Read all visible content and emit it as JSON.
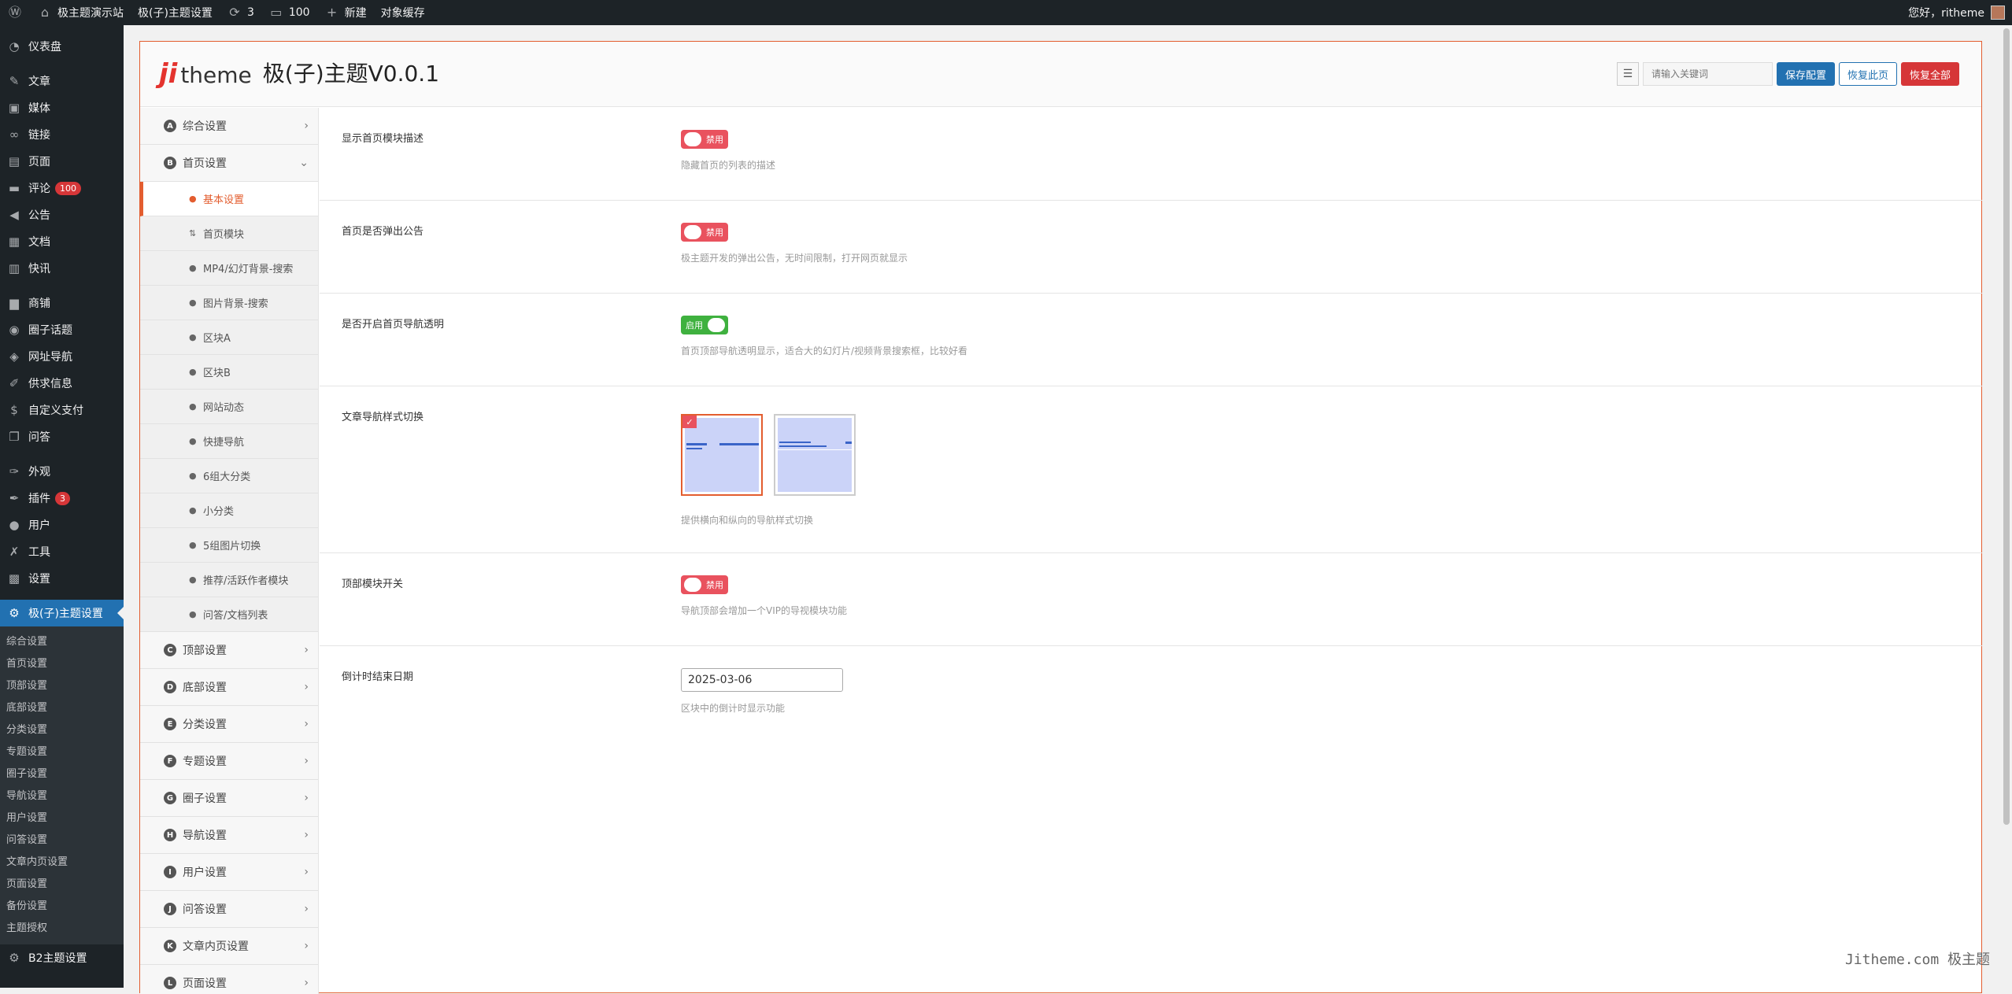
{
  "adminbar": {
    "site_name": "极主题演示站",
    "theme_settings": "极(子)主题设置",
    "updates_count": "3",
    "comments_count": "100",
    "new_label": "新建",
    "cache_label": "对象缓存",
    "greeting": "您好，ritheme"
  },
  "sidebar": {
    "items": [
      {
        "label": "仪表盘",
        "icon": "dashboard-icon"
      },
      {
        "label": "文章",
        "icon": "pin-icon"
      },
      {
        "label": "媒体",
        "icon": "media-icon"
      },
      {
        "label": "链接",
        "icon": "link-icon"
      },
      {
        "label": "页面",
        "icon": "page-icon"
      },
      {
        "label": "评论",
        "icon": "comment-icon",
        "badge": "100"
      },
      {
        "label": "公告",
        "icon": "megaphone-icon"
      },
      {
        "label": "文档",
        "icon": "doc-icon"
      },
      {
        "label": "快讯",
        "icon": "flash-icon"
      },
      {
        "label": "商铺",
        "icon": "shop-icon"
      },
      {
        "label": "圈子话题",
        "icon": "circle-icon"
      },
      {
        "label": "网址导航",
        "icon": "nav-icon"
      },
      {
        "label": "供求信息",
        "icon": "supply-icon"
      },
      {
        "label": "自定义支付",
        "icon": "dollar-icon"
      },
      {
        "label": "问答",
        "icon": "qa-icon"
      },
      {
        "label": "外观",
        "icon": "brush-icon"
      },
      {
        "label": "插件",
        "icon": "plugin-icon",
        "badge": "3"
      },
      {
        "label": "用户",
        "icon": "user-icon"
      },
      {
        "label": "工具",
        "icon": "wrench-icon"
      },
      {
        "label": "设置",
        "icon": "settings-icon"
      }
    ],
    "current": {
      "label": "极(子)主题设置",
      "icon": "gear-icon"
    },
    "submenu": [
      "综合设置",
      "首页设置",
      "顶部设置",
      "底部设置",
      "分类设置",
      "专题设置",
      "圈子设置",
      "导航设置",
      "用户设置",
      "问答设置",
      "文章内页设置",
      "页面设置",
      "备份设置",
      "主题授权"
    ],
    "bottom": {
      "label": "B2主题设置",
      "icon": "gear-icon"
    }
  },
  "header": {
    "logo_ji": "ji",
    "logo_theme": "theme",
    "version_title": "极(子)主题V0.0.1",
    "search_placeholder": "请输入关键词",
    "save_label": "保存配置",
    "reset_page_label": "恢复此页",
    "reset_all_label": "恢复全部"
  },
  "optnav": {
    "top_items": [
      {
        "letter": "A",
        "label": "综合设置",
        "chev": "›"
      },
      {
        "letter": "B",
        "label": "首页设置",
        "chev": "⌄"
      }
    ],
    "subitems": [
      "基本设置",
      "首页模块",
      "MP4/幻灯背景-搜索",
      "图片背景-搜索",
      "区块A",
      "区块B",
      "网站动态",
      "快捷导航",
      "6组大分类",
      "小分类",
      "5组图片切换",
      "推荐/活跃作者模块",
      "问答/文档列表"
    ],
    "active_sub": 0,
    "bottom_items": [
      {
        "letter": "C",
        "label": "顶部设置"
      },
      {
        "letter": "D",
        "label": "底部设置"
      },
      {
        "letter": "E",
        "label": "分类设置"
      },
      {
        "letter": "F",
        "label": "专题设置"
      },
      {
        "letter": "G",
        "label": "圈子设置"
      },
      {
        "letter": "H",
        "label": "导航设置"
      },
      {
        "letter": "I",
        "label": "用户设置"
      },
      {
        "letter": "J",
        "label": "问答设置"
      },
      {
        "letter": "K",
        "label": "文章内页设置"
      },
      {
        "letter": "L",
        "label": "页面设置"
      }
    ]
  },
  "fields": {
    "f1": {
      "label": "显示首页模块描述",
      "state": "禁用",
      "desc": "隐藏首页的列表的描述"
    },
    "f2": {
      "label": "首页是否弹出公告",
      "state": "禁用",
      "desc": "极主题开发的弹出公告，无时间限制，打开网页就显示"
    },
    "f3": {
      "label": "是否开启首页导航透明",
      "state": "启用",
      "desc": "首页顶部导航透明显示，适合大的幻灯片/视频背景搜索框，比较好看"
    },
    "f4": {
      "label": "文章导航样式切换",
      "desc": "提供横向和纵向的导航样式切换"
    },
    "f5": {
      "label": "顶部模块开关",
      "state": "禁用",
      "desc": "导航顶部会增加一个VIP的导视模块功能"
    },
    "f6": {
      "label": "倒计时结束日期",
      "value": "2025-03-06",
      "desc": "区块中的倒计时显示功能"
    }
  },
  "watermark": "Jitheme.com 极主题"
}
